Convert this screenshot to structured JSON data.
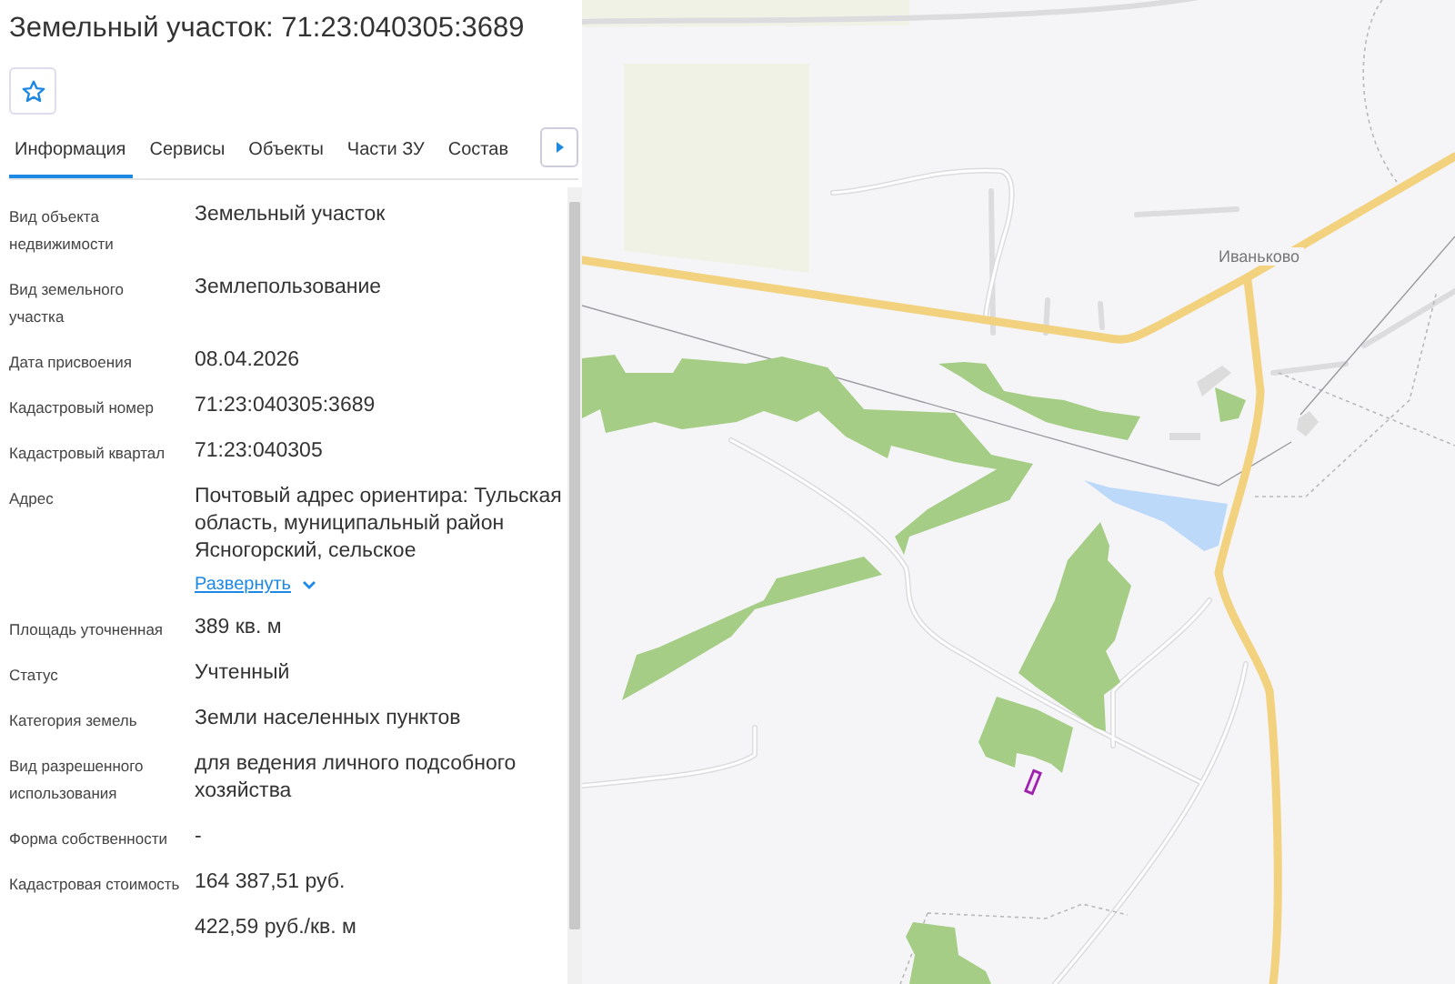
{
  "title": "Земельный участок: 71:23:040305:3689",
  "tabs": [
    {
      "label": "Информация",
      "selected": true
    },
    {
      "label": "Сервисы",
      "selected": false
    },
    {
      "label": "Объекты",
      "selected": false
    },
    {
      "label": "Части ЗУ",
      "selected": false
    },
    {
      "label": "Состав",
      "selected": false
    }
  ],
  "fields": [
    {
      "label": "Вид объекта недвижимости",
      "value": "Земельный участок"
    },
    {
      "label": "Вид земельного участка",
      "value": "Землепользование"
    },
    {
      "label": "Дата присвоения",
      "value": "08.04.2026"
    },
    {
      "label": "Кадастровый номер",
      "value": "71:23:040305:3689"
    },
    {
      "label": "Кадастровый квартал",
      "value": "71:23:040305"
    },
    {
      "label": "Адрес",
      "value": "Почтовый адрес ориентира: Тульская область, муниципальный район Ясногорский, сельское",
      "link": "Развернуть"
    },
    {
      "label": "Площадь уточненная",
      "value": "389 кв. м"
    },
    {
      "label": "Статус",
      "value": "Учтенный"
    },
    {
      "label": "Категория земель",
      "value": "Земли населенных пунктов"
    },
    {
      "label": "Вид разрешенного использования",
      "value": "для ведения личного подсобного хозяйства"
    },
    {
      "label": "Форма собственности",
      "value": "-"
    },
    {
      "label": "Кадастровая стоимость",
      "value": "164 387,51 руб."
    },
    {
      "value": "422,59 руб./кв. м"
    }
  ],
  "map": {
    "place_label": "Иваньково"
  }
}
